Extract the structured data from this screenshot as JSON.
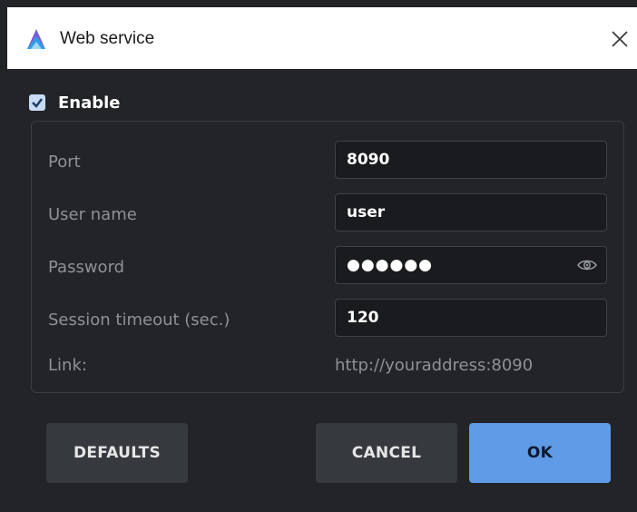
{
  "window": {
    "title": "Web service"
  },
  "enable": {
    "label": "Enable",
    "checked": true
  },
  "fields": {
    "port": {
      "label": "Port",
      "value": "8090"
    },
    "user_name": {
      "label": "User name",
      "value": "user"
    },
    "password": {
      "label": "Password",
      "value": "●●●●●●"
    },
    "session_timeout": {
      "label": "Session timeout (sec.)",
      "value": "120"
    },
    "link": {
      "label": "Link:",
      "value": "http://youraddress:8090"
    }
  },
  "buttons": {
    "defaults": "DEFAULTS",
    "cancel": "CANCEL",
    "ok": "OK"
  },
  "icons": {
    "app": "app-logo-icon",
    "close": "close-icon",
    "eye": "eye-icon",
    "check": "checkmark-icon"
  },
  "colors": {
    "accent": "#5f9be6",
    "background": "#222427",
    "field_bg": "#1a1b1e",
    "label": "#8e9297"
  }
}
